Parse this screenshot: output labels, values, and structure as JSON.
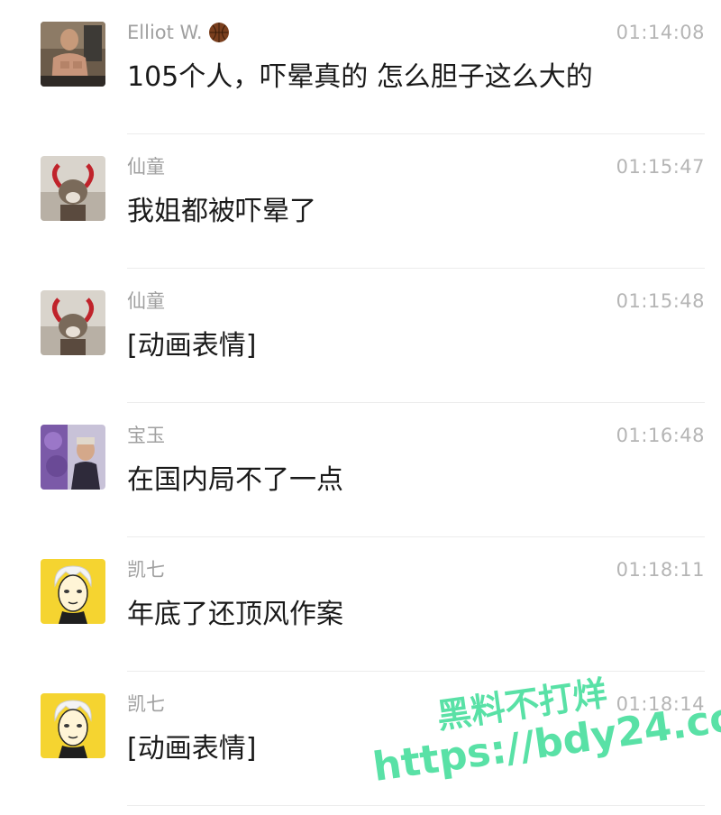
{
  "messages": [
    {
      "sender": "Elliot W.",
      "sender_emoji": "basketball-icon",
      "time": "01:14:08",
      "text": "105个人，吓晕真的 怎么胆子这么大的",
      "avatar": "elliot-avatar"
    },
    {
      "sender": "仙童",
      "time": "01:15:47",
      "text": "我姐都被吓晕了",
      "avatar": "xiantong-avatar"
    },
    {
      "sender": "仙童",
      "time": "01:15:48",
      "text": "[动画表情]",
      "avatar": "xiantong-avatar"
    },
    {
      "sender": "宝玉",
      "time": "01:16:48",
      "text": "在国内局不了一点",
      "avatar": "baoyu-avatar"
    },
    {
      "sender": "凯七",
      "time": "01:18:11",
      "text": "年底了还顶风作案",
      "avatar": "kaiqi-avatar"
    },
    {
      "sender": "凯七",
      "time": "01:18:14",
      "text": "[动画表情]",
      "avatar": "kaiqi-avatar"
    }
  ],
  "watermark": {
    "line1": "黑料不打烊",
    "line2": "https://bdy24.co"
  },
  "colors": {
    "watermark": "#3ddc97",
    "sender": "#a0a0a0",
    "time": "#b5b5b5",
    "text": "#1a1a1a",
    "avatar_yellow": "#f5d430"
  }
}
